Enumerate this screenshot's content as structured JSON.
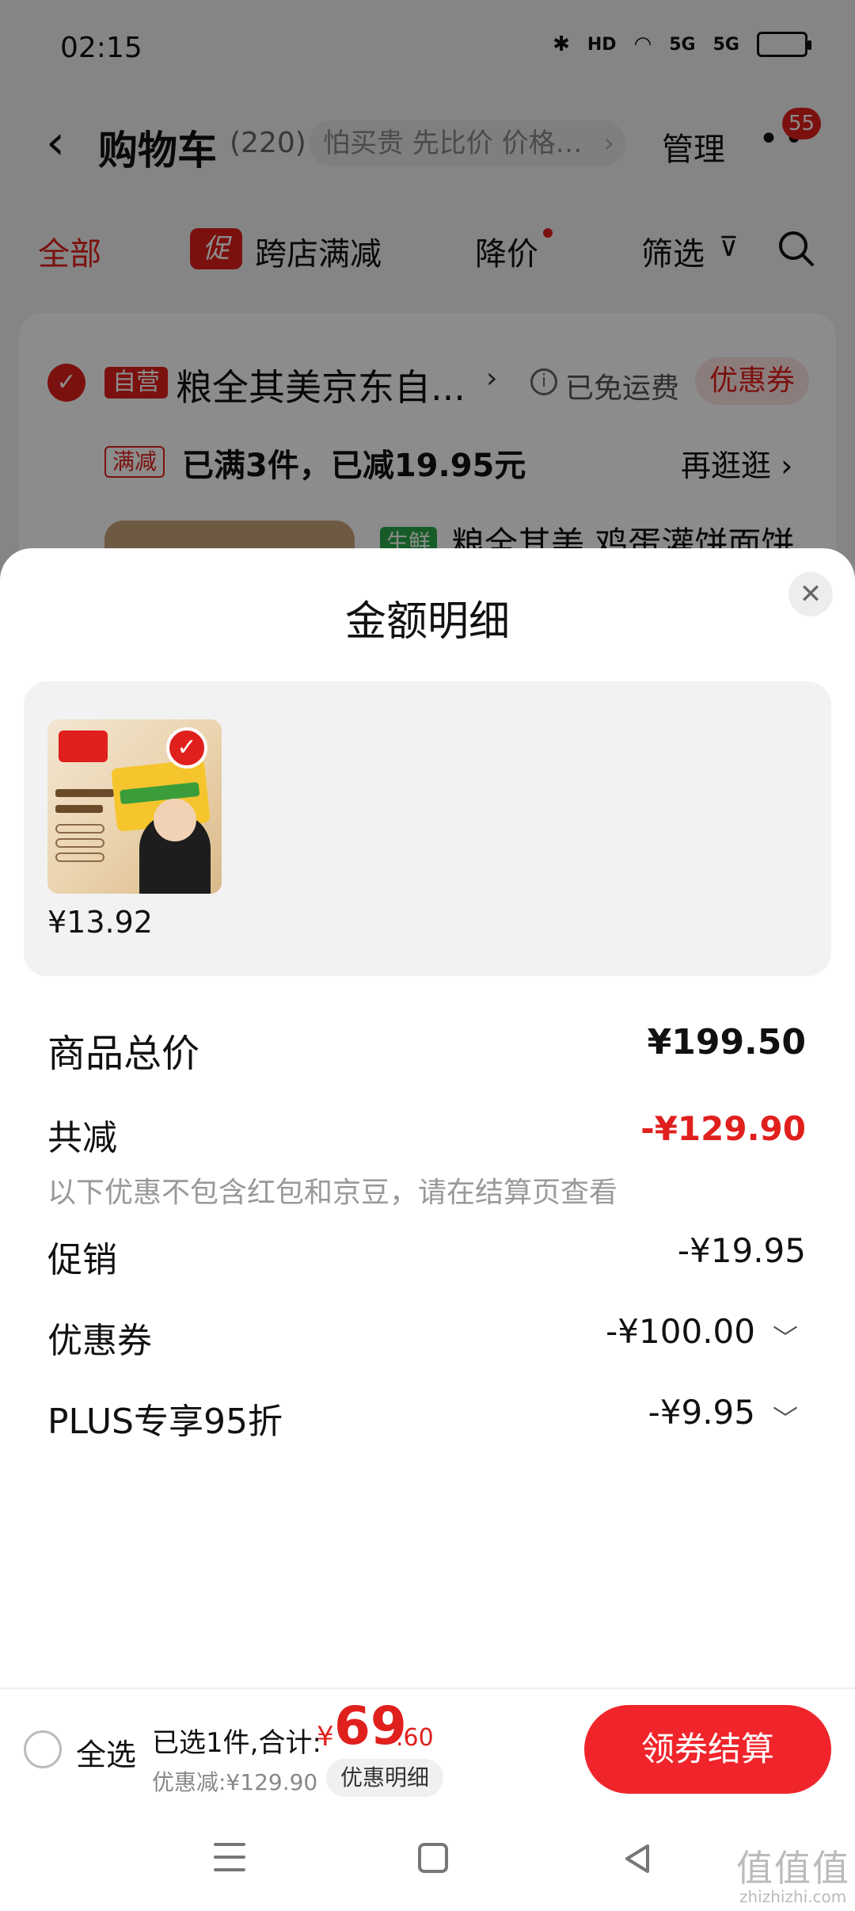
{
  "status_bar": {
    "time": "02:15",
    "network": "5G",
    "hd": "HD"
  },
  "header": {
    "back_icon": "chevron-left-icon",
    "title": "购物车",
    "count": "(220)",
    "search_hint": "怕买贵 先比价 价格…",
    "manage": "管理",
    "more_icon": "more-dots-icon",
    "badge": "55"
  },
  "filters": {
    "all": "全部",
    "promo_tag": "促",
    "promo": "跨店满减",
    "price_drop": "降价",
    "filter": "筛选"
  },
  "shop": {
    "self_tag": "自营",
    "name": "粮全其美京东自...",
    "free_shipping": "已免运费",
    "coupon": "优惠券",
    "promo_tag": "满减",
    "promo_text": "已满3件，已减19.95元",
    "stroll": "再逛逛",
    "fresh_tag": "生鲜",
    "product_name": "粮全其美 鸡蛋灌饼面饼"
  },
  "sheet": {
    "title": "金额明细",
    "item_price": "¥13.92",
    "total_label": "商品总价",
    "total_value": "¥199.50",
    "reduce_label": "共减",
    "reduce_value": "-¥129.90",
    "note": "以下优惠不包含红包和京豆，请在结算页查看",
    "promo_label": "促销",
    "promo_value": "-¥19.95",
    "coupon_label": "优惠券",
    "coupon_value": "-¥100.00",
    "plus_label": "PLUS专享95折",
    "plus_value": "-¥9.95"
  },
  "checkout": {
    "select_all": "全选",
    "selected": "已选1件,合计:",
    "currency": "¥",
    "sum_int": "69",
    "sum_dec": ".60",
    "saved": "优惠减:¥129.90",
    "detail": "优惠明细",
    "button": "领券结算"
  },
  "watermark": {
    "main": "值值值",
    "sub": "zhizhizhi.com"
  },
  "colors": {
    "accent": "#e0201d",
    "button": "#f0252b",
    "overlay": "rgba(0,0,0,0.45)"
  }
}
